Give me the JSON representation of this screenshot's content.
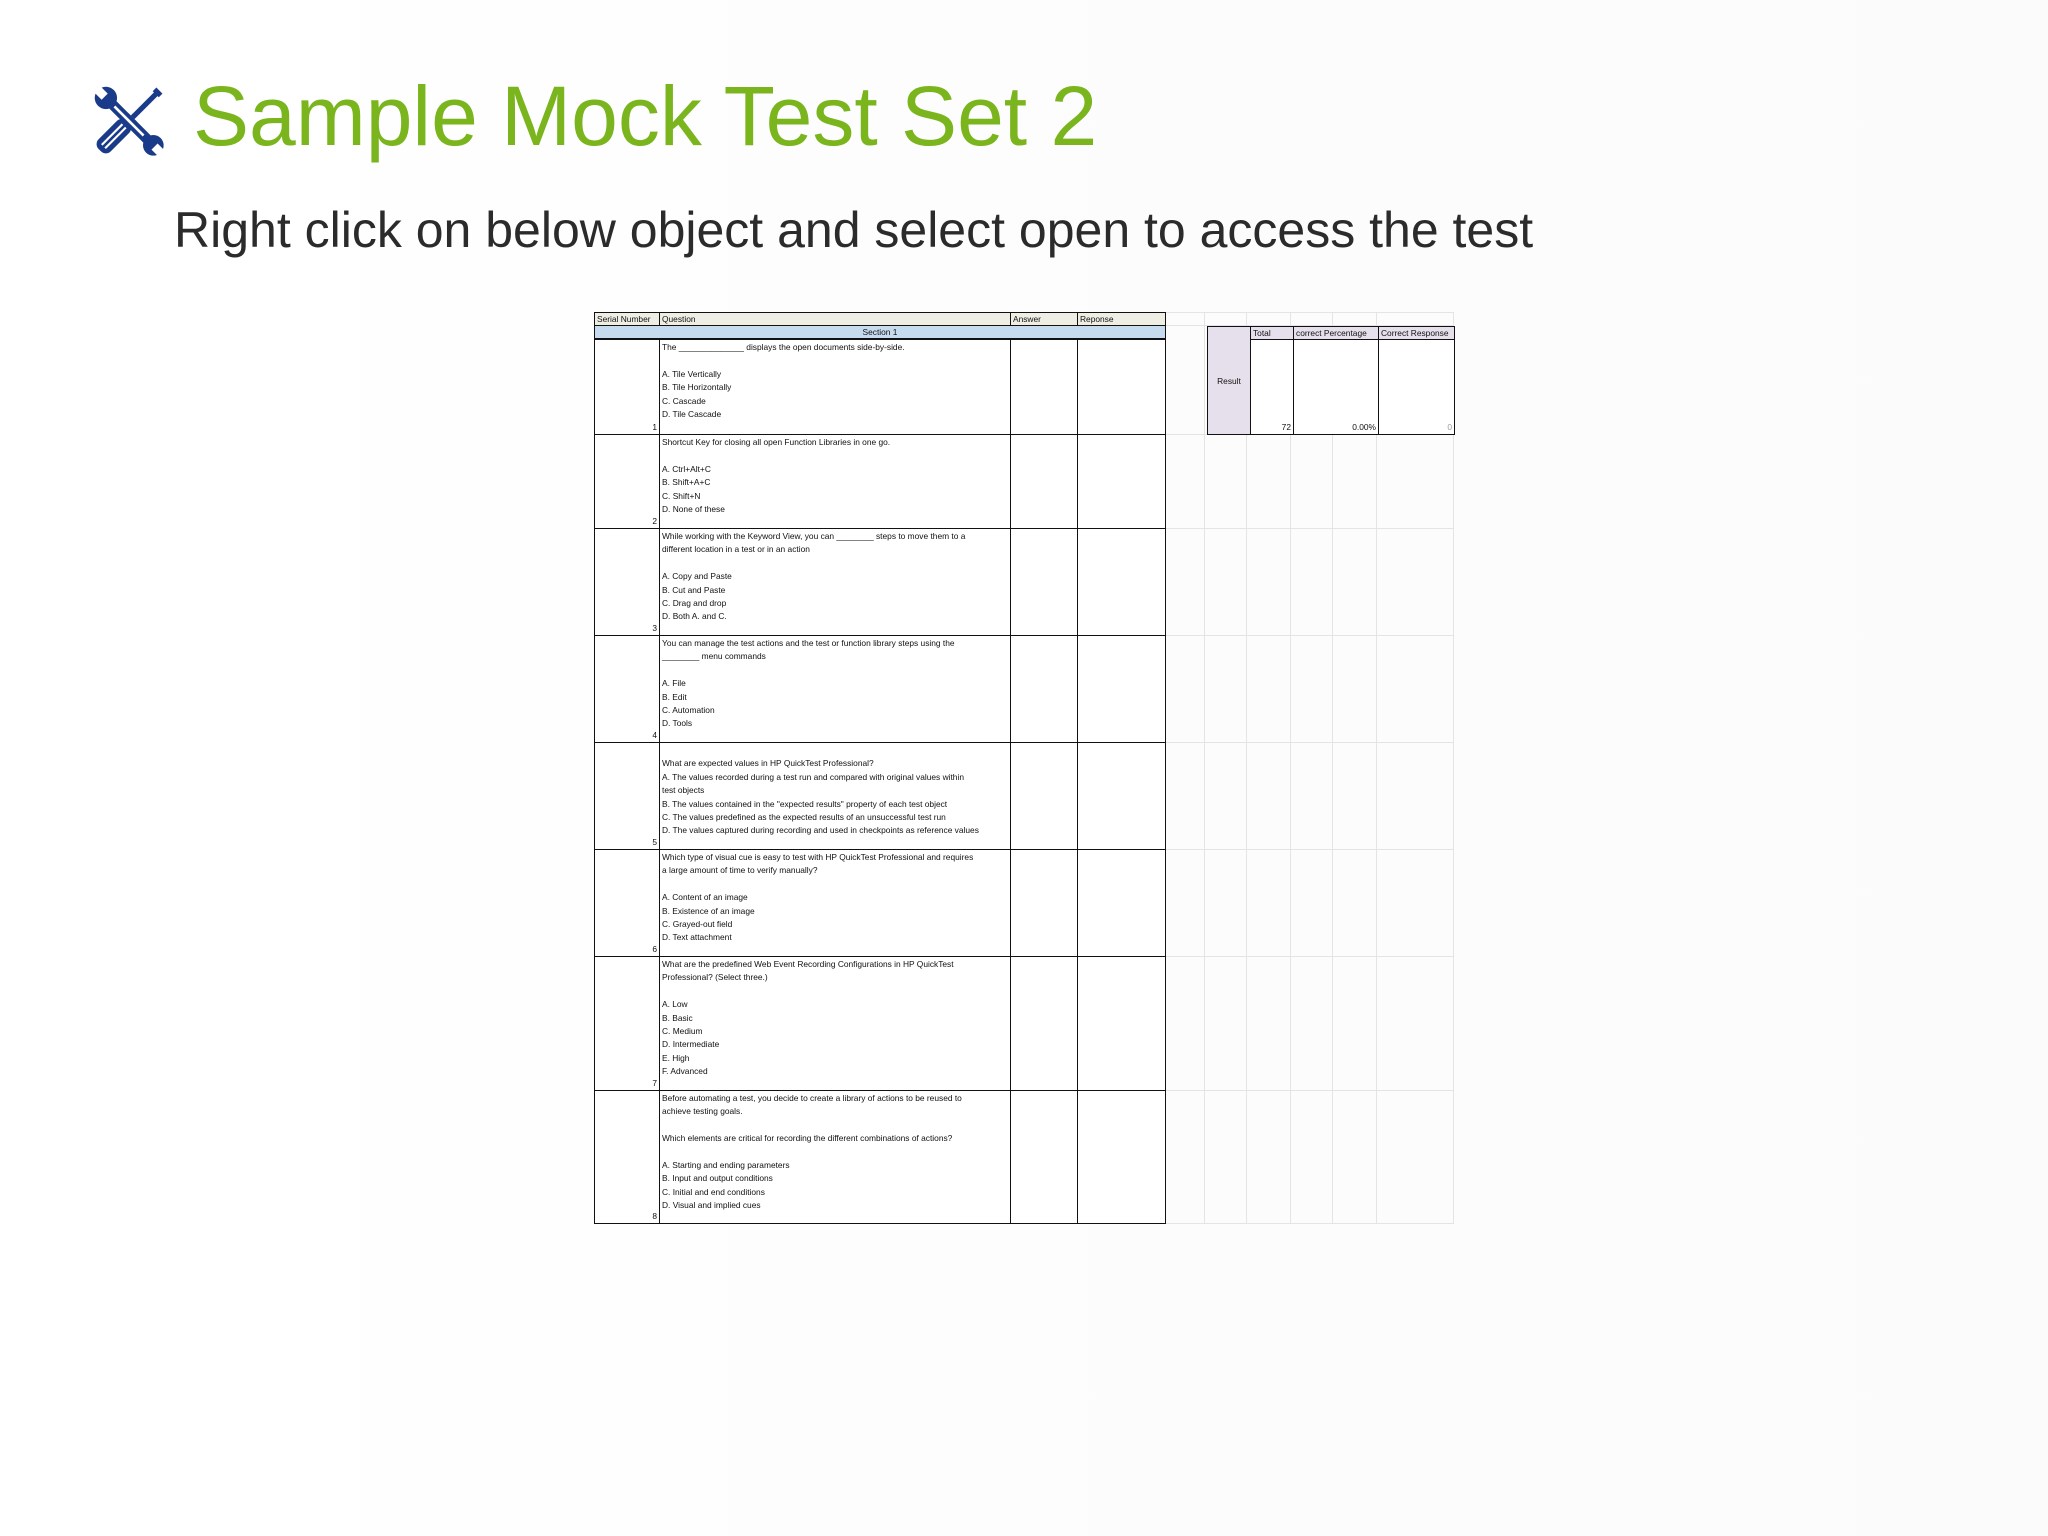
{
  "slide": {
    "title": "Sample Mock Test Set 2",
    "subtitle": "Right click on below object and select open to access the test",
    "title_icon": "tools-icon",
    "title_color": "#7ab51d"
  },
  "sheet": {
    "headers": {
      "serial": "Serial Number",
      "question": "Question",
      "answer": "Answer",
      "response": "Reponse"
    },
    "section_label": "Section 1",
    "questions": [
      {
        "number": "1",
        "text": "The ______________ displays the open documents side-by-side.\n\nA. Tile Vertically\nB. Tile Horizontally\nC. Cascade\nD. Tile Cascade"
      },
      {
        "number": "2",
        "text": "Shortcut Key for closing all open Function Libraries in one go.\n\nA. Ctrl+Alt+C\nB. Shift+A+C\nC. Shift+N\nD. None of these"
      },
      {
        "number": "3",
        "text": "While working with the Keyword View, you can ________ steps to move them to a\ndifferent location in a test or in an action\n\nA. Copy and Paste\nB. Cut and Paste\nC. Drag and drop\nD. Both A. and C."
      },
      {
        "number": "4",
        "text": "You can manage the test actions and the test or function library steps using the\n________ menu commands\n\nA. File\nB. Edit\nC. Automation\nD. Tools"
      },
      {
        "number": "5",
        "text": "\nWhat are expected values in HP QuickTest Professional?\nA. The values recorded during a test run and compared with original values within\ntest objects\nB. The values contained in the \"expected results\" property of each test object\nC. The values predefined as the expected results of an unsuccessful test run\nD. The values captured during recording and used in checkpoints as reference values"
      },
      {
        "number": "6",
        "text": "Which type of visual cue is easy to test with HP QuickTest Professional and requires\na large amount of time to verify manually?\n\nA. Content of an image\nB. Existence of an image\nC. Grayed-out field\nD. Text attachment"
      },
      {
        "number": "7",
        "text": "What are the predefined Web Event Recording Configurations in HP QuickTest\nProfessional? (Select three.)\n\nA. Low\nB. Basic\nC. Medium\nD. Intermediate\nE. High\nF. Advanced"
      },
      {
        "number": "8",
        "text": "Before automating a test, you decide to create a library of actions to be reused to\nachieve testing goals.\n\nWhich elements are critical for recording the different combinations of actions?\n\nA. Starting and ending parameters\nB. Input and output conditions\nC. Initial and end conditions\nD. Visual and implied cues"
      }
    ],
    "result_panel": {
      "label": "Result",
      "total_header": "Total",
      "percentage_header": "correct Percentage",
      "correct_header": "Correct Response",
      "total_value": "72",
      "percentage_value": "0.00%",
      "correct_value": "0"
    }
  }
}
